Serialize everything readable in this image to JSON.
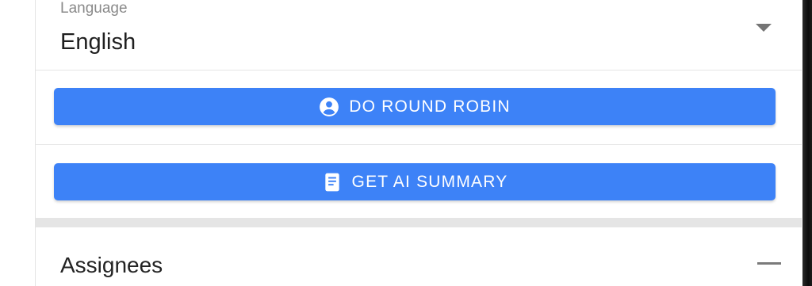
{
  "language": {
    "label": "Language",
    "value": "English",
    "caret_icon": "dropdown-caret-icon"
  },
  "actions": [
    {
      "label": "DO ROUND ROBIN",
      "icon": "account-circle-icon"
    },
    {
      "label": "GET AI SUMMARY",
      "icon": "document-icon"
    }
  ],
  "assignees": {
    "title": "Assignees",
    "toggle_icon": "collapse-minus-icon"
  },
  "colors": {
    "button": "#3d82f7",
    "button_text": "#ffffff",
    "band": "#e5e5e5"
  }
}
